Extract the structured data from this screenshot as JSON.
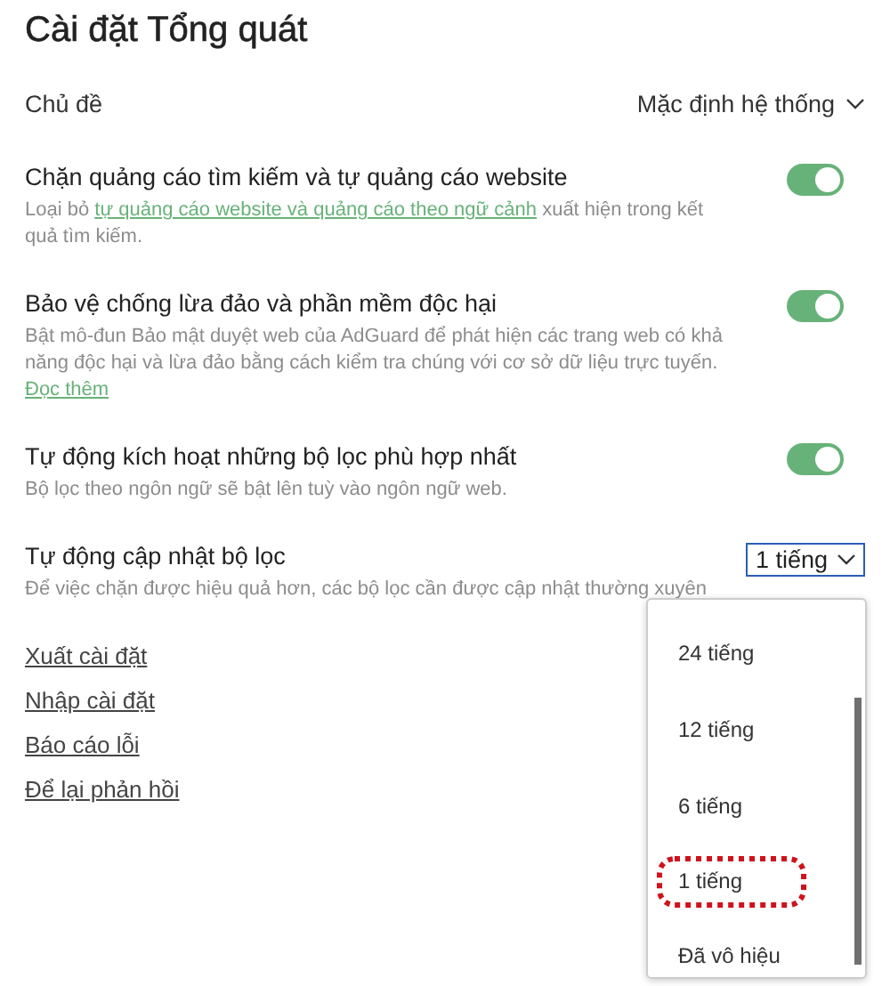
{
  "title": "Cài đặt Tổng quát",
  "theme": {
    "label": "Chủ đề",
    "value": "Mặc định hệ thống"
  },
  "options": [
    {
      "label": "Chặn quảng cáo tìm kiếm và tự quảng cáo website",
      "before": "Loại bỏ ",
      "link": "tự quảng cáo website và quảng cáo theo ngữ cảnh",
      "after": " xuất hiện trong kết quả tìm kiếm.",
      "on": true
    },
    {
      "label": "Bảo vệ chống lừa đảo và phần mềm độc hại",
      "before": "Bật mô-đun Bảo mật duyệt web của AdGuard để phát hiện các trang web có khả năng độc hại và lừa đảo bằng cách kiểm tra chúng với cơ sở dữ liệu trực tuyến. ",
      "link": "Đọc thêm",
      "on": true
    },
    {
      "label": "Tự động kích hoạt những bộ lọc phù hợp nhất",
      "before": "Bộ lọc theo ngôn ngữ sẽ bật lên tuỳ vào ngôn ngữ web.",
      "on": true
    }
  ],
  "update": {
    "label": "Tự động cập nhật bộ lọc",
    "description": "Để việc chặn được hiệu quả hơn, các bộ lọc cần được cập nhật thường xuyên",
    "value": "1 tiếng",
    "expanded": true,
    "menu": [
      {
        "label": "24 tiếng",
        "selected": false
      },
      {
        "label": "12 tiếng",
        "selected": false
      },
      {
        "label": "6 tiếng",
        "selected": false
      },
      {
        "label": "1 tiếng",
        "selected": true
      },
      {
        "label": "Đã vô hiệu",
        "selected": false
      }
    ]
  },
  "links": [
    "Xuất cài đặt",
    "Nhập cài đặt",
    "Báo cáo lỗi",
    "Để lại phản hồi"
  ]
}
